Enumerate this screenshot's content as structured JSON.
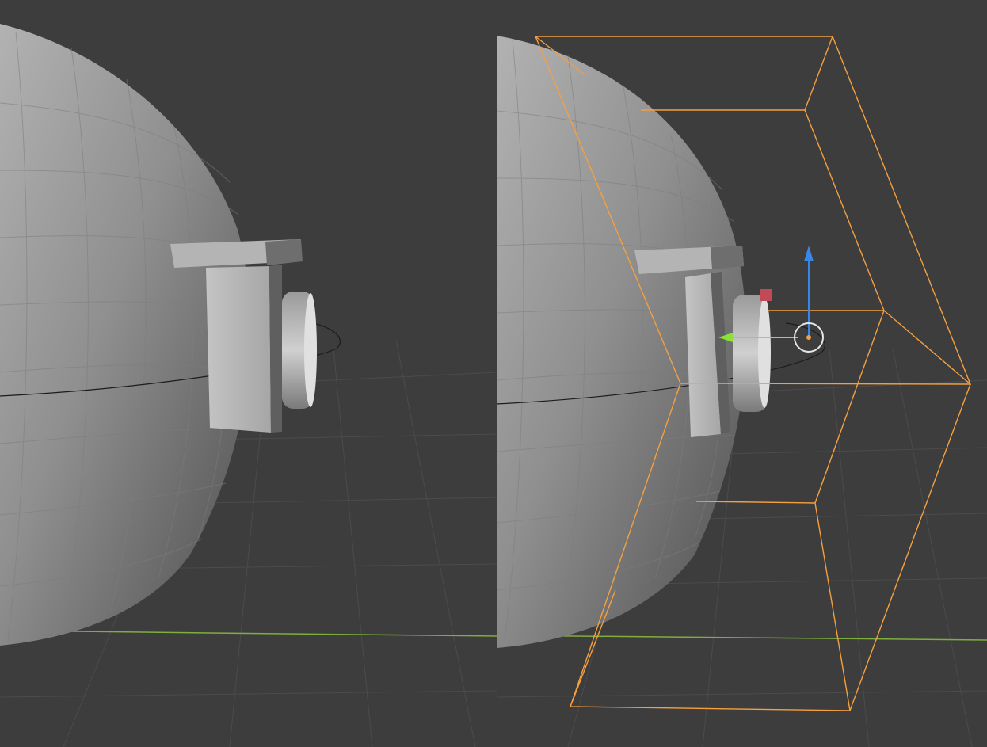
{
  "app": "3D viewport",
  "viewports": [
    {
      "id": "left",
      "selected": false
    },
    {
      "id": "right",
      "selected": true
    }
  ],
  "colors": {
    "background": "#3d3d3d",
    "grid_line": "#4a4a4a",
    "x_axis": "#a1c44a",
    "selection_outline": "#f5a040",
    "gizmo_y_arrow": "#8be03a",
    "gizmo_z_arrow": "#3a86e8",
    "gizmo_x_handle": "#c24a57",
    "mesh_light": "#a0a0a0",
    "mesh_dark": "#5a5a5a"
  },
  "icons": [
    "move-gizmo-icon",
    "z-axis-arrow-icon",
    "y-axis-arrow-icon",
    "x-axis-handle-icon",
    "object-origin-icon"
  ]
}
